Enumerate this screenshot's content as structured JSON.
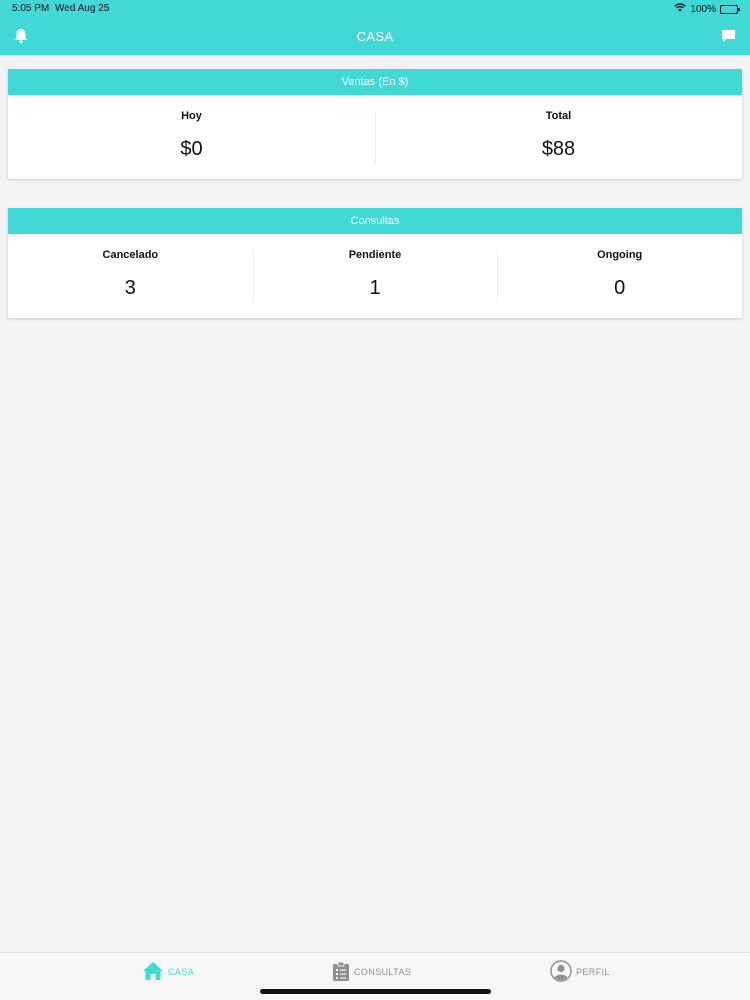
{
  "status_bar": {
    "time": "5:05 PM",
    "date": "Wed Aug 25",
    "battery": "100%",
    "wifi_icon": "wifi-icon",
    "battery_icon": "battery-icon"
  },
  "nav": {
    "title": "CASA",
    "left_icon": "bell-icon",
    "right_icon": "message-icon"
  },
  "ventas": {
    "title": "Ventas (En $)",
    "stats": [
      {
        "label": "Hoy",
        "value": "$0"
      },
      {
        "label": "Total",
        "value": "$88"
      }
    ]
  },
  "consultas": {
    "title": "Consultas",
    "stats": [
      {
        "label": "Cancelado",
        "value": "3"
      },
      {
        "label": "Pendiente",
        "value": "1"
      },
      {
        "label": "Ongoing",
        "value": "0"
      }
    ]
  },
  "tabbar": {
    "items": [
      {
        "label": "CASA",
        "icon": "home-icon",
        "active": true
      },
      {
        "label": "CONSULTAS",
        "icon": "clipboard-icon",
        "active": false
      },
      {
        "label": "PERFIL",
        "icon": "profile-icon",
        "active": false
      }
    ]
  },
  "colors": {
    "accent": "#41d8d6",
    "background": "#f4f4f6",
    "inactive": "#8e8e93"
  }
}
